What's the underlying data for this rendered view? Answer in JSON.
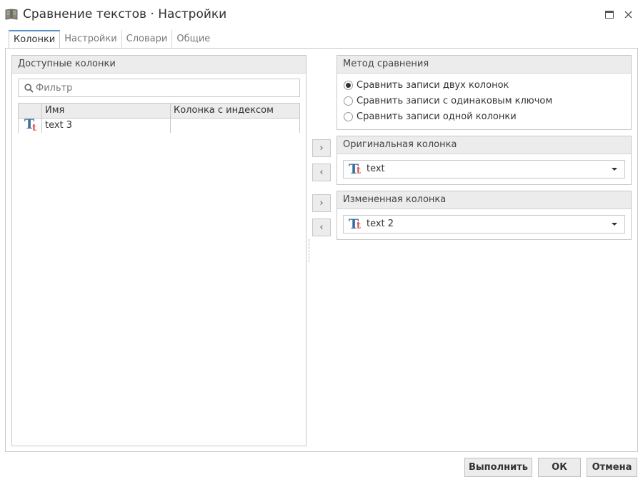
{
  "window": {
    "title": "Сравнение текстов · Настройки",
    "icons": {
      "app": "book-icon",
      "maximize": "maximize-icon",
      "close": "close-icon"
    }
  },
  "tabs": [
    {
      "label": "Колонки",
      "active": true
    },
    {
      "label": "Настройки",
      "active": false
    },
    {
      "label": "Словари",
      "active": false
    },
    {
      "label": "Общие",
      "active": false
    }
  ],
  "available_columns": {
    "header": "Доступные колонки",
    "filter_placeholder": "Фильтр",
    "filter_icon": "search-icon",
    "table": {
      "headers": [
        "",
        "Имя",
        "Колонка с индексом"
      ],
      "rows": [
        {
          "icon": "text-type-icon",
          "name": "text 3",
          "index_column": ""
        }
      ]
    }
  },
  "transfer_buttons": {
    "move_right": "›",
    "move_left": "‹"
  },
  "method": {
    "header": "Метод сравнения",
    "options": [
      {
        "label": "Сравнить записи двух колонок",
        "checked": true
      },
      {
        "label": "Сравнить записи с одинаковым ключом",
        "checked": false
      },
      {
        "label": "Сравнить записи одной колонки",
        "checked": false
      }
    ]
  },
  "original_column": {
    "header": "Оригинальная колонка",
    "value": "text",
    "icon": "text-type-icon"
  },
  "modified_column": {
    "header": "Измененная колонка",
    "value": "text 2",
    "icon": "text-type-icon"
  },
  "footer": {
    "run": "Выполнить",
    "ok": "ОК",
    "cancel": "Отмена"
  },
  "colors": {
    "accent": "#5b8fc9",
    "tt_blue": "#3b6e9e",
    "tt_red": "#d9534f",
    "header_bg": "#ececec",
    "border": "#c8c8c8"
  }
}
